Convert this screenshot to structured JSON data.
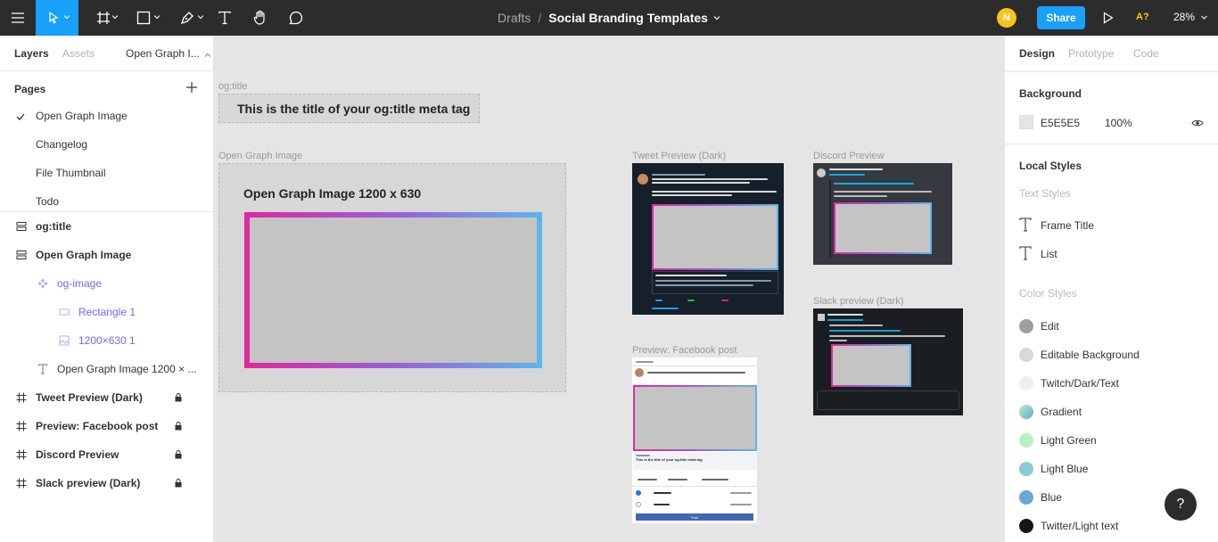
{
  "toolbar": {
    "breadcrumb_project": "Drafts",
    "breadcrumb_separator": "/",
    "file_name": "Social Branding Templates",
    "avatar_initial": "N",
    "share_label": "Share",
    "missing_fonts_badge": "A?",
    "zoom": "28%",
    "icons": [
      "menu-icon",
      "move-icon",
      "frame-icon",
      "rectangle-icon",
      "pen-icon",
      "text-icon",
      "hand-icon",
      "comment-icon",
      "play-icon"
    ]
  },
  "left_panel": {
    "tabs": {
      "layers": "Layers",
      "assets": "Assets",
      "page_selector": "Open Graph I..."
    },
    "pages_header": "Pages",
    "pages": [
      "Open Graph Image",
      "Changelog",
      "File Thumbnail",
      "Todo"
    ],
    "layers": [
      {
        "label": "og:title",
        "icon": "section-icon"
      },
      {
        "label": "Open Graph Image",
        "icon": "section-icon"
      },
      {
        "label": "og-image",
        "icon": "component-icon"
      },
      {
        "label": "Rectangle 1",
        "icon": "rectangle-icon"
      },
      {
        "label": "1200×630 1",
        "icon": "image-icon"
      },
      {
        "label": "Open Graph Image 1200 × ...",
        "icon": "text-icon"
      },
      {
        "label": "Tweet Preview (Dark)",
        "icon": "frame-icon",
        "locked": true
      },
      {
        "label": "Preview: Facebook post",
        "icon": "frame-icon",
        "locked": true
      },
      {
        "label": "Discord Preview",
        "icon": "frame-icon",
        "locked": true
      },
      {
        "label": "Slack preview (Dark)",
        "icon": "frame-icon",
        "locked": true
      }
    ]
  },
  "canvas": {
    "og_title_label": "og:title",
    "og_title_text": "This is the title of your og:title meta tag",
    "og_frame_label": "Open Graph Image",
    "og_frame_title": "Open Graph Image 1200 x 630",
    "tweet_label": "Tweet Preview (Dark)",
    "discord_label": "Discord Preview",
    "slack_label": "Slack preview (Dark)",
    "facebook_label": "Preview: Facebook post",
    "fb_title": "This is the title of your og:title meta tag",
    "fb_post_button": "Post"
  },
  "right_panel": {
    "tabs": {
      "design": "Design",
      "prototype": "Prototype",
      "code": "Code"
    },
    "background_header": "Background",
    "background_hex": "E5E5E5",
    "background_opacity": "100%",
    "local_styles_header": "Local Styles",
    "text_styles_header": "Text Styles",
    "text_styles": [
      "Frame Title",
      "List"
    ],
    "color_styles_header": "Color Styles",
    "color_styles": [
      {
        "name": "Edit",
        "color": "#9e9e9e"
      },
      {
        "name": "Editable Background",
        "color": "#d9d9d9"
      },
      {
        "name": "Twitch/Dark/Text",
        "color": "#efeff1"
      },
      {
        "name": "Gradient",
        "color": "#7fd0c9"
      },
      {
        "name": "Light Green",
        "color": "#b4f1c3"
      },
      {
        "name": "Light Blue",
        "color": "#86ccd3"
      },
      {
        "name": "Blue",
        "color": "#6aa6d6"
      },
      {
        "name": "Twitter/Light text",
        "color": "#14171a"
      }
    ]
  },
  "help_label": "?",
  "colors": {
    "accent": "#18a0fb",
    "toolbar_bg": "#2c2c2c",
    "selection": "#7b61ff",
    "avatar": "#f7c31f"
  }
}
